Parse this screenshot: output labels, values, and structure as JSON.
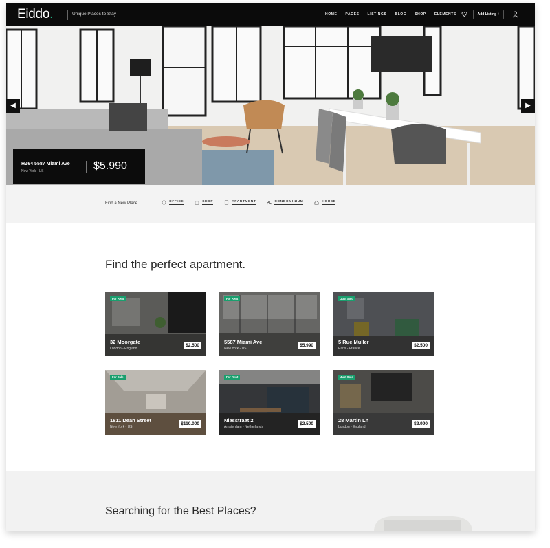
{
  "nav": {
    "logo_text": "Eiddo",
    "logo_dot": ".",
    "tagline": "Unique Places to Stay",
    "menu": [
      "HOME",
      "PAGES",
      "LISTINGS",
      "BLOG",
      "SHOP",
      "ELEMENTS"
    ],
    "add_listing": "Add Listing +"
  },
  "hero": {
    "address": "HZ64 5587 Miami Ave",
    "location": "New York - US",
    "price": "$5.990"
  },
  "strip": {
    "label": "Find a New Place",
    "categories": [
      "OFFICE",
      "SHOP",
      "APARTMENT",
      "CONDOMINIUM",
      "HOUSE"
    ]
  },
  "section": {
    "title": "Find the perfect apartment."
  },
  "listings": [
    {
      "badge": "For Rent",
      "title": "32 Moorgate",
      "location": "London - England",
      "price": "$2.500"
    },
    {
      "badge": "For Rent",
      "title": "5587 Miami Ave",
      "location": "New York - US",
      "price": "$5.990"
    },
    {
      "badge": "Just Sold",
      "title": "5 Rue Muller",
      "location": "Paris - France",
      "price": "$2.500"
    },
    {
      "badge": "For Sale",
      "title": "1811 Dean Street",
      "location": "New York - US",
      "price": "$110.000"
    },
    {
      "badge": "For Rent",
      "title": "Niasstraat 2",
      "location": "Amsterdam - Netherlands",
      "price": "$2.500"
    },
    {
      "badge": "Just Sold",
      "title": "28 Martin Ln",
      "location": "London - England",
      "price": "$2.990"
    }
  ],
  "bottom": {
    "title": "Searching for the Best Places?"
  },
  "colors": {
    "accent": "#1fae80",
    "badge": "#1a9f6e",
    "nav_bg": "#0b0b0b"
  }
}
